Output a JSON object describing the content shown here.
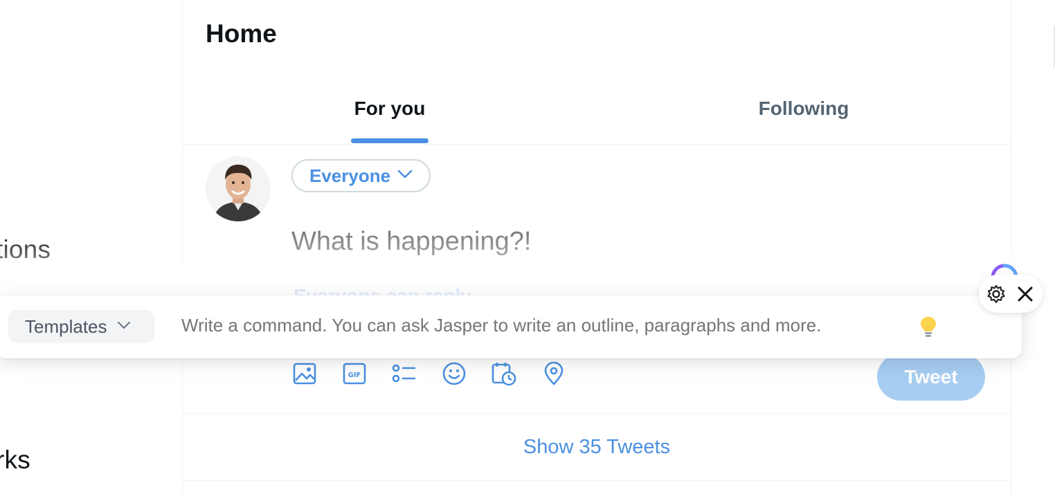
{
  "sidebar": {
    "items": [
      {
        "label": "tions"
      },
      {
        "label": "rks"
      }
    ]
  },
  "header": {
    "title": "Home"
  },
  "tabs": [
    {
      "label": "For you",
      "active": true
    },
    {
      "label": "Following",
      "active": false
    }
  ],
  "composer": {
    "avatar_alt": "user-avatar",
    "audience_label": "Everyone",
    "placeholder": "What is happening?!",
    "reply_setting": "Everyone can reply",
    "tweet_label": "Tweet",
    "toolbar_icons": [
      "image-icon",
      "gif-icon",
      "poll-icon",
      "emoji-icon",
      "schedule-icon",
      "location-icon"
    ]
  },
  "feed": {
    "show_more_label": "Show 35 Tweets"
  },
  "jasper": {
    "templates_label": "Templates",
    "command_placeholder": "Write a command. You can ask Jasper to write an outline, paragraphs and more."
  },
  "colors": {
    "accent": "#4a90e2",
    "tweet_button_disabled": "#a7cdf2",
    "text_primary": "#0f1419",
    "text_secondary": "#536471"
  }
}
